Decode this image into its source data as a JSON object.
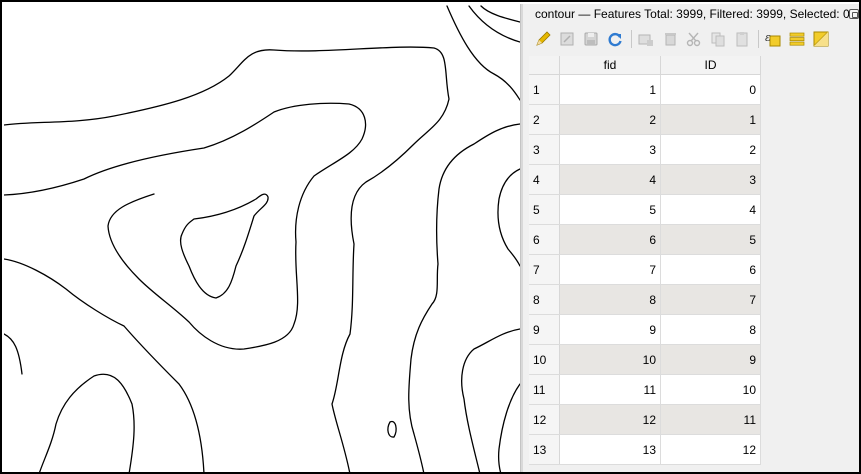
{
  "attribute_table": {
    "title": "contour — Features Total: 3999, Filtered: 3999, Selected: 0",
    "columns": [
      "fid",
      "ID"
    ],
    "rows": [
      {
        "n": "1",
        "fid": "1",
        "id": "0"
      },
      {
        "n": "2",
        "fid": "2",
        "id": "1"
      },
      {
        "n": "3",
        "fid": "3",
        "id": "2"
      },
      {
        "n": "4",
        "fid": "4",
        "id": "3"
      },
      {
        "n": "5",
        "fid": "5",
        "id": "4"
      },
      {
        "n": "6",
        "fid": "6",
        "id": "5"
      },
      {
        "n": "7",
        "fid": "7",
        "id": "6"
      },
      {
        "n": "8",
        "fid": "8",
        "id": "7"
      },
      {
        "n": "9",
        "fid": "9",
        "id": "8"
      },
      {
        "n": "10",
        "fid": "10",
        "id": "9"
      },
      {
        "n": "11",
        "fid": "11",
        "id": "10"
      },
      {
        "n": "12",
        "fid": "12",
        "id": "11"
      },
      {
        "n": "13",
        "fid": "13",
        "id": "12"
      }
    ]
  },
  "toolbar": {
    "buttons": [
      {
        "icon": "pencil-icon",
        "enabled": true
      },
      {
        "icon": "edit-table-icon",
        "enabled": false
      },
      {
        "icon": "save-icon",
        "enabled": false
      },
      {
        "icon": "refresh-icon",
        "enabled": true
      },
      {
        "icon": "add-feature-icon",
        "enabled": false
      },
      {
        "icon": "delete-icon",
        "enabled": false
      },
      {
        "icon": "cut-icon",
        "enabled": false
      },
      {
        "icon": "copy-icon",
        "enabled": false
      },
      {
        "icon": "paste-icon",
        "enabled": false
      },
      {
        "icon": "expression-select-icon",
        "enabled": true
      },
      {
        "icon": "select-all-icon",
        "enabled": true
      },
      {
        "icon": "invert-selection-icon",
        "enabled": true
      }
    ]
  },
  "colors": {
    "alt_row": "#e8e6e3",
    "icon_yellow": "#e6b800",
    "icon_blue": "#2f7bd1"
  }
}
